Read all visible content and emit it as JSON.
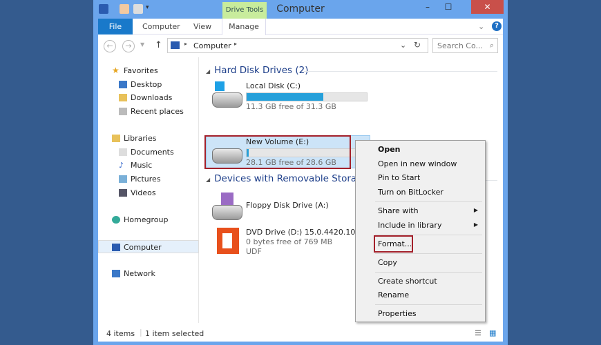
{
  "window": {
    "title": "Computer",
    "context_tab": "Drive Tools"
  },
  "ribbon": {
    "tabs": [
      "File",
      "Computer",
      "View",
      "Manage"
    ]
  },
  "address": {
    "path": "Computer",
    "search_placeholder": "Search Co..."
  },
  "sidebar": {
    "items": [
      "Favorites",
      "Desktop",
      "Downloads",
      "Recent places",
      "Libraries",
      "Documents",
      "Music",
      "Pictures",
      "Videos",
      "Homegroup",
      "Computer",
      "Network"
    ]
  },
  "groups": {
    "hdd": "Hard Disk Drives (2)",
    "removable": "Devices with Removable Storage"
  },
  "drives": [
    {
      "name": "Local Disk (C:)",
      "free": "11.3 GB free of 31.3 GB",
      "used_pct": 64
    },
    {
      "name": "New Volume (E:)",
      "free": "28.1 GB free of 28.6 GB",
      "used_pct": 2
    },
    {
      "name": "Floppy Disk Drive (A:)"
    },
    {
      "name": "DVD Drive (D:) 15.0.4420.1017",
      "free": "0 bytes free of 769 MB",
      "fs": "UDF"
    }
  ],
  "context_menu": [
    "Open",
    "Open in new window",
    "Pin to Start",
    "Turn on BitLocker",
    "Share with",
    "Include in library",
    "Format...",
    "Copy",
    "Create shortcut",
    "Rename",
    "Properties"
  ],
  "status": {
    "items": "4 items",
    "selected": "1 item selected"
  },
  "colors": {
    "accent": "#1979ca",
    "highlight": "#a3202a",
    "bar": "#26a0da"
  }
}
